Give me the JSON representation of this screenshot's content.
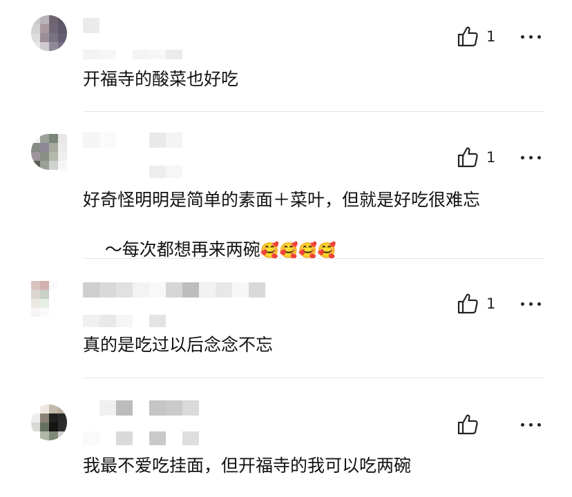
{
  "comments": [
    {
      "text": "开福寺的酸菜也好吃",
      "likes": "1"
    },
    {
      "text": "好奇怪明明是简单的素面＋菜叶，但就是好吃很难忘",
      "text_line2": "～每次都想再来两碗",
      "emojis": "🥰🥰🥰🥰",
      "likes": "1"
    },
    {
      "text": "真的是吃过以后念念不忘",
      "likes": "1"
    },
    {
      "text": "我最不爱吃挂面，但开福寺的我可以吃两碗",
      "likes": ""
    }
  ],
  "icons": {
    "like": "thumbs-up-icon",
    "more": "more-horizontal-icon"
  },
  "colors": {
    "text": "#111111",
    "divider": "#e6e6e6",
    "icon": "#222222"
  }
}
